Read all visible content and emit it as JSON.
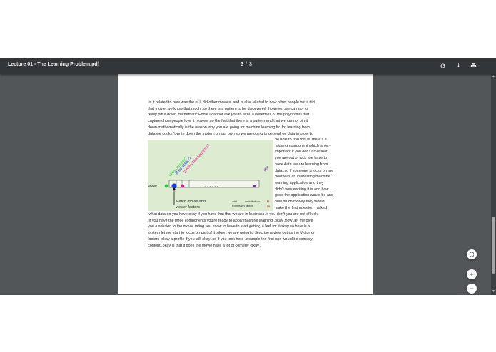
{
  "toolbar": {
    "title": "Lecture 01 - The Learning Problem.pdf",
    "current_page": "3",
    "page_separator": "/",
    "total_pages": "3"
  },
  "icons": {
    "rotate": "rotate-icon",
    "download": "download-icon",
    "print": "print-icon",
    "fit": "fit-to-page-icon",
    "zoom_in": "zoom-in-icon",
    "zoom_out": "zoom-out-icon"
  },
  "page": {
    "top_lines": [
      ".is it related to how was the of it did other movies .and is also related to how other people but it did",
      "that movie .we know that much .so there is a pattern to be discovered .however .we can not to",
      "really pin it down mathematic Eddie I cannot ask you to write a seventies or the polynomial that",
      "captures how people love it movies .so the fact that there is a pattern and that we cannot pin it",
      "down mathematically is the reason why you are going for machine learning fro for learning from",
      "data we couldn't write down the system on our own so we are going to depend on data in order to"
    ],
    "side_lines": [
      "be able to find this is .there's a",
      "missing component which is very",
      "important if you don't have that",
      "you are out of luck .we have to",
      "have data we are learning from",
      "data .so if someone knocks on my",
      "door was an interesting machine",
      "learning application and they",
      "didn't how exciting it is and how",
      "good the application would be and",
      "how much money they would",
      "make the first question I asked"
    ],
    "bottom_lines": [
      ".what data do you have okay if you have that that we are in business .if you don't you are out of luck",
      ".if you have the three components you're ready to apply machine learning .okay .now .let me give",
      "you a solution to the movie rating you know to have to start getting a feel for it okay so here is a",
      "system let me start to focus on part of it .okay .we are going to describe a view out as the Victor or",
      "factors .okay a profile if you will okay .so if you look here .example the first one would be comedy",
      "content .okay is that it does the movie have a lot of comedy .okay ."
    ],
    "figure": {
      "viewer_label": "iewer",
      "likes_comedy": "likes comedy?",
      "likes_action": "likes action?",
      "prefers_blockbusters": "prefers blockbusters?",
      "likes_clipped": "like",
      "dashes": "- - - - - -",
      "match_line1": "Match movie and",
      "match_line2": "viewer factors",
      "add": "add",
      "contributions": "contributions",
      "from_each_factor": "from each factor",
      "marker_top": "R",
      "marker_bottom": "ra"
    }
  }
}
